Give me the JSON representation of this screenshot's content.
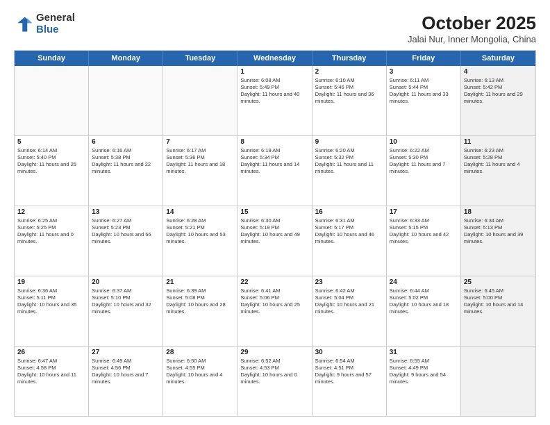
{
  "logo": {
    "general": "General",
    "blue": "Blue"
  },
  "title": "October 2025",
  "subtitle": "Jalai Nur, Inner Mongolia, China",
  "headers": [
    "Sunday",
    "Monday",
    "Tuesday",
    "Wednesday",
    "Thursday",
    "Friday",
    "Saturday"
  ],
  "weeks": [
    [
      {
        "day": "",
        "text": "",
        "empty": true
      },
      {
        "day": "",
        "text": "",
        "empty": true
      },
      {
        "day": "",
        "text": "",
        "empty": true
      },
      {
        "day": "1",
        "text": "Sunrise: 6:08 AM\nSunset: 5:49 PM\nDaylight: 11 hours and 40 minutes."
      },
      {
        "day": "2",
        "text": "Sunrise: 6:10 AM\nSunset: 5:46 PM\nDaylight: 11 hours and 36 minutes."
      },
      {
        "day": "3",
        "text": "Sunrise: 6:11 AM\nSunset: 5:44 PM\nDaylight: 11 hours and 33 minutes."
      },
      {
        "day": "4",
        "text": "Sunrise: 6:13 AM\nSunset: 5:42 PM\nDaylight: 11 hours and 29 minutes.",
        "shaded": true
      }
    ],
    [
      {
        "day": "5",
        "text": "Sunrise: 6:14 AM\nSunset: 5:40 PM\nDaylight: 11 hours and 25 minutes."
      },
      {
        "day": "6",
        "text": "Sunrise: 6:16 AM\nSunset: 5:38 PM\nDaylight: 11 hours and 22 minutes."
      },
      {
        "day": "7",
        "text": "Sunrise: 6:17 AM\nSunset: 5:36 PM\nDaylight: 11 hours and 18 minutes."
      },
      {
        "day": "8",
        "text": "Sunrise: 6:19 AM\nSunset: 5:34 PM\nDaylight: 11 hours and 14 minutes."
      },
      {
        "day": "9",
        "text": "Sunrise: 6:20 AM\nSunset: 5:32 PM\nDaylight: 11 hours and 11 minutes."
      },
      {
        "day": "10",
        "text": "Sunrise: 6:22 AM\nSunset: 5:30 PM\nDaylight: 11 hours and 7 minutes."
      },
      {
        "day": "11",
        "text": "Sunrise: 6:23 AM\nSunset: 5:28 PM\nDaylight: 11 hours and 4 minutes.",
        "shaded": true
      }
    ],
    [
      {
        "day": "12",
        "text": "Sunrise: 6:25 AM\nSunset: 5:25 PM\nDaylight: 11 hours and 0 minutes."
      },
      {
        "day": "13",
        "text": "Sunrise: 6:27 AM\nSunset: 5:23 PM\nDaylight: 10 hours and 56 minutes."
      },
      {
        "day": "14",
        "text": "Sunrise: 6:28 AM\nSunset: 5:21 PM\nDaylight: 10 hours and 53 minutes."
      },
      {
        "day": "15",
        "text": "Sunrise: 6:30 AM\nSunset: 5:19 PM\nDaylight: 10 hours and 49 minutes."
      },
      {
        "day": "16",
        "text": "Sunrise: 6:31 AM\nSunset: 5:17 PM\nDaylight: 10 hours and 46 minutes."
      },
      {
        "day": "17",
        "text": "Sunrise: 6:33 AM\nSunset: 5:15 PM\nDaylight: 10 hours and 42 minutes."
      },
      {
        "day": "18",
        "text": "Sunrise: 6:34 AM\nSunset: 5:13 PM\nDaylight: 10 hours and 39 minutes.",
        "shaded": true
      }
    ],
    [
      {
        "day": "19",
        "text": "Sunrise: 6:36 AM\nSunset: 5:11 PM\nDaylight: 10 hours and 35 minutes."
      },
      {
        "day": "20",
        "text": "Sunrise: 6:37 AM\nSunset: 5:10 PM\nDaylight: 10 hours and 32 minutes."
      },
      {
        "day": "21",
        "text": "Sunrise: 6:39 AM\nSunset: 5:08 PM\nDaylight: 10 hours and 28 minutes."
      },
      {
        "day": "22",
        "text": "Sunrise: 6:41 AM\nSunset: 5:06 PM\nDaylight: 10 hours and 25 minutes."
      },
      {
        "day": "23",
        "text": "Sunrise: 6:42 AM\nSunset: 5:04 PM\nDaylight: 10 hours and 21 minutes."
      },
      {
        "day": "24",
        "text": "Sunrise: 6:44 AM\nSunset: 5:02 PM\nDaylight: 10 hours and 18 minutes."
      },
      {
        "day": "25",
        "text": "Sunrise: 6:45 AM\nSunset: 5:00 PM\nDaylight: 10 hours and 14 minutes.",
        "shaded": true
      }
    ],
    [
      {
        "day": "26",
        "text": "Sunrise: 6:47 AM\nSunset: 4:58 PM\nDaylight: 10 hours and 11 minutes."
      },
      {
        "day": "27",
        "text": "Sunrise: 6:49 AM\nSunset: 4:56 PM\nDaylight: 10 hours and 7 minutes."
      },
      {
        "day": "28",
        "text": "Sunrise: 6:50 AM\nSunset: 4:55 PM\nDaylight: 10 hours and 4 minutes."
      },
      {
        "day": "29",
        "text": "Sunrise: 6:52 AM\nSunset: 4:53 PM\nDaylight: 10 hours and 0 minutes."
      },
      {
        "day": "30",
        "text": "Sunrise: 6:54 AM\nSunset: 4:51 PM\nDaylight: 9 hours and 57 minutes."
      },
      {
        "day": "31",
        "text": "Sunrise: 6:55 AM\nSunset: 4:49 PM\nDaylight: 9 hours and 54 minutes."
      },
      {
        "day": "",
        "text": "",
        "empty": true,
        "shaded": true
      }
    ]
  ]
}
